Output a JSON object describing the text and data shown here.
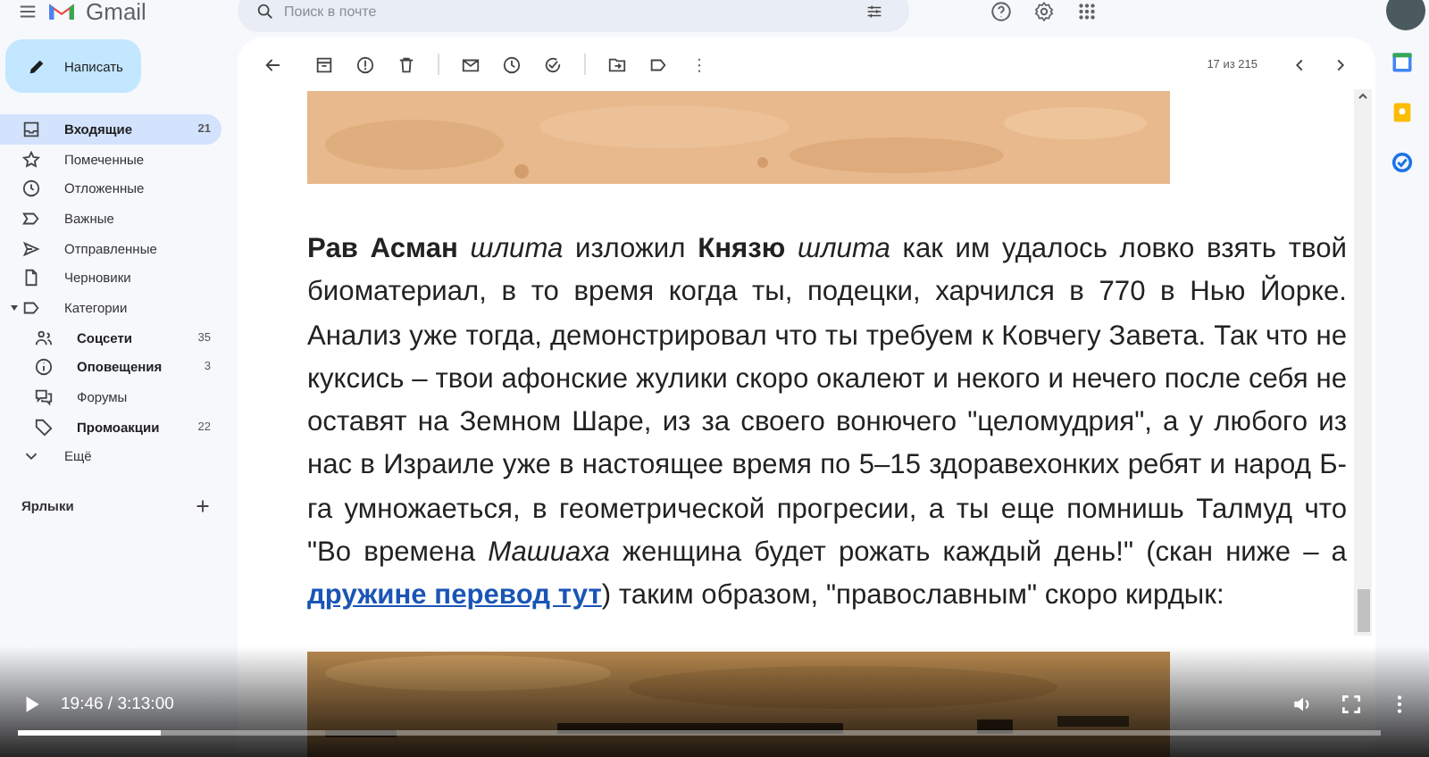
{
  "header": {
    "brand": "Gmail",
    "search": {
      "placeholder": "Поиск в почте"
    }
  },
  "nav": {
    "compose": "Написать",
    "items": [
      {
        "label": "Входящие",
        "count": "21",
        "selected": true,
        "unread": true
      },
      {
        "label": "Помеченные",
        "selected": false,
        "unread": false
      },
      {
        "label": "Отложенные",
        "selected": false,
        "unread": false
      },
      {
        "label": "Важные",
        "selected": false,
        "unread": false
      },
      {
        "label": "Отправленные",
        "selected": false,
        "unread": false
      },
      {
        "label": "Черновики",
        "selected": false,
        "unread": false
      },
      {
        "label": "Категории",
        "selected": false,
        "unread": false,
        "expanded": true,
        "children": [
          {
            "label": "Соцсети",
            "count": "35",
            "selected": false,
            "unread": true
          },
          {
            "label": "Оповещения",
            "count": "3",
            "selected": false,
            "unread": true
          },
          {
            "label": "Форумы",
            "selected": false,
            "unread": false
          },
          {
            "label": "Промоакции",
            "count": "22",
            "selected": false,
            "unread": true
          }
        ]
      },
      {
        "label": "Ещё",
        "selected": false,
        "unread": false
      }
    ],
    "labels_title": "Ярлыки"
  },
  "message": {
    "pager": "17 из 215",
    "paragraph": {
      "before": "**Рав Асман** *шлита* изложил **Князю** *шлита* как им удалось ловко взять твой биоматериал, в то время когда ты, подецки, харчился в 770 в Нью Йорке. Анализ уже тогда, демонстрировал что ты требуем к Ковчегу Завета. Так что не куксись – твои афонские жулики скоро окалеют и некого и нечего после себя не оставят на Земном Шаре, из за своего вонючего \"целомудрия\", а у любого из нас в Израиле уже в настоящее время по 5–15 здоравехонких ребят и народ Б-га умножаеться, в геометрической прогресии, а ты еще помнишь Талмуд что \"Во времена *Машиаха* женщина будет рожать каждый день!\" (скан ниже – а ",
      "link": "дружине перевод тут",
      "after": ") таким образом, \"православным\" скоро кирдык:"
    }
  },
  "player": {
    "time": "19:46 / 3:13:00",
    "level": 0.105
  }
}
